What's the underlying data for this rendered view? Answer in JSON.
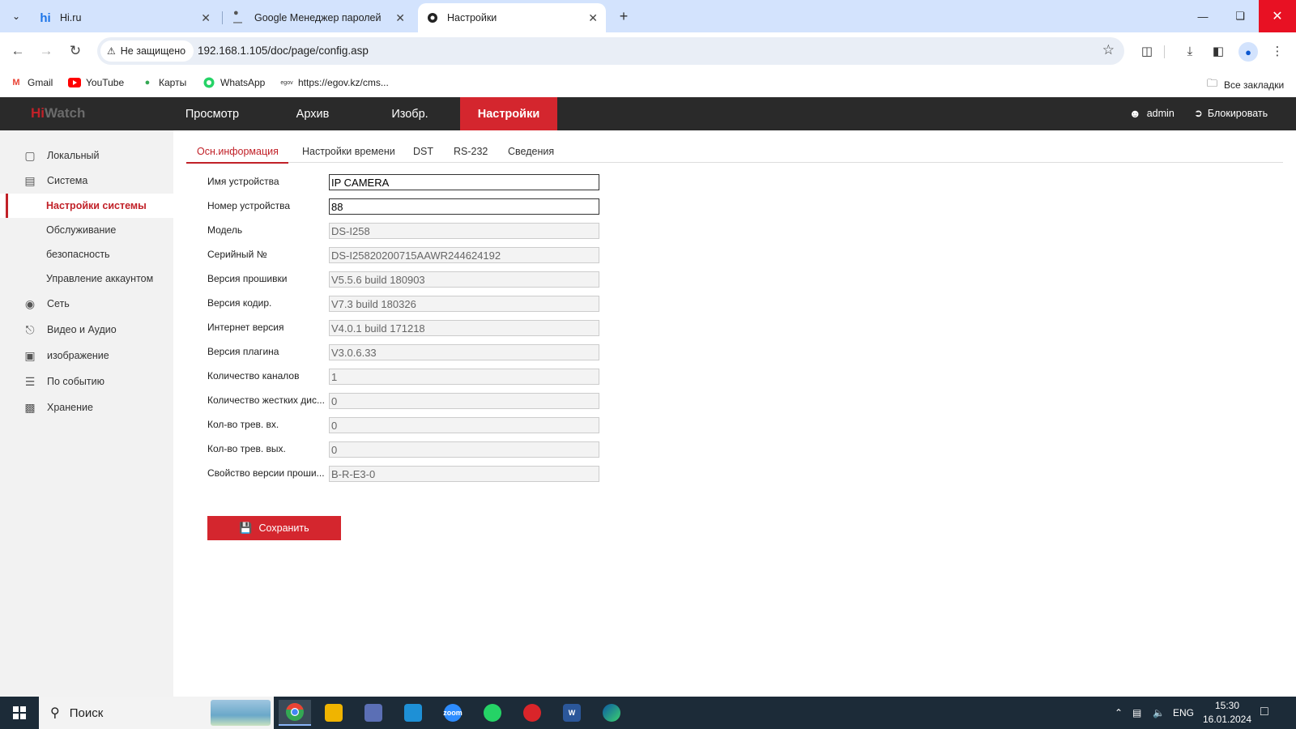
{
  "browser": {
    "tabs": [
      {
        "title": "Hi.ru",
        "favicon": "hi"
      },
      {
        "title": "Google Менеджер паролей",
        "favicon": "key"
      },
      {
        "title": "Настройки",
        "favicon": "camera"
      }
    ],
    "security_label": "Не защищено",
    "url": "192.168.1.105/doc/page/config.asp",
    "bookmarks": [
      "Gmail",
      "YouTube",
      "Карты",
      "WhatsApp",
      "https://egov.kz/cms..."
    ],
    "all_bookmarks": "Все закладки"
  },
  "app": {
    "logo_hi": "Hi",
    "logo_watch": "Watch",
    "nav": [
      "Просмотр",
      "Архив",
      "Изобр.",
      "Настройки"
    ],
    "user": "admin",
    "lock": "Блокировать"
  },
  "sidebar": {
    "items": [
      {
        "label": "Локальный",
        "icon": "monitor-icon"
      },
      {
        "label": "Система",
        "icon": "system-icon"
      },
      {
        "label": "Настройки системы",
        "sub": true,
        "active": true
      },
      {
        "label": "Обслуживание",
        "sub": true
      },
      {
        "label": "безопасность",
        "sub": true
      },
      {
        "label": "Управление аккаунтом",
        "sub": true
      },
      {
        "label": "Сеть",
        "icon": "globe-icon"
      },
      {
        "label": "Видео и Аудио",
        "icon": "mic-icon"
      },
      {
        "label": "изображение",
        "icon": "image-icon"
      },
      {
        "label": "По событию",
        "icon": "event-icon"
      },
      {
        "label": "Хранение",
        "icon": "storage-icon"
      }
    ]
  },
  "content": {
    "tabs": [
      "Осн.информация",
      "Настройки времени",
      "DST",
      "RS-232",
      "Сведения"
    ],
    "fields": [
      {
        "label": "Имя устройства",
        "value": "IP CAMERA",
        "editable": true
      },
      {
        "label": "Номер устройства",
        "value": "88",
        "editable": true
      },
      {
        "label": "Модель",
        "value": "DS-I258"
      },
      {
        "label": "Серийный №",
        "value": "DS-I25820200715AAWR244624192"
      },
      {
        "label": "Версия прошивки",
        "value": "V5.5.6 build 180903"
      },
      {
        "label": "Версия кодир.",
        "value": "V7.3 build 180326"
      },
      {
        "label": "Интернет версия",
        "value": "V4.0.1 build 171218"
      },
      {
        "label": "Версия плагина",
        "value": "V3.0.6.33"
      },
      {
        "label": "Количество каналов",
        "value": "1"
      },
      {
        "label": "Количество жестких дис...",
        "value": "0"
      },
      {
        "label": "Кол-во трев. вх.",
        "value": "0"
      },
      {
        "label": "Кол-во трев. вых.",
        "value": "0"
      },
      {
        "label": "Свойство версии проши...",
        "value": "B-R-E3-0"
      }
    ],
    "save_label": "Сохранить"
  },
  "taskbar": {
    "search": "Поиск",
    "lang": "ENG",
    "time": "15:30",
    "date": "16.01.2024"
  },
  "colors": {
    "brand_red": "#d4262e",
    "header_bg": "#2a2a2a",
    "sidebar_bg": "#f2f2f2"
  }
}
